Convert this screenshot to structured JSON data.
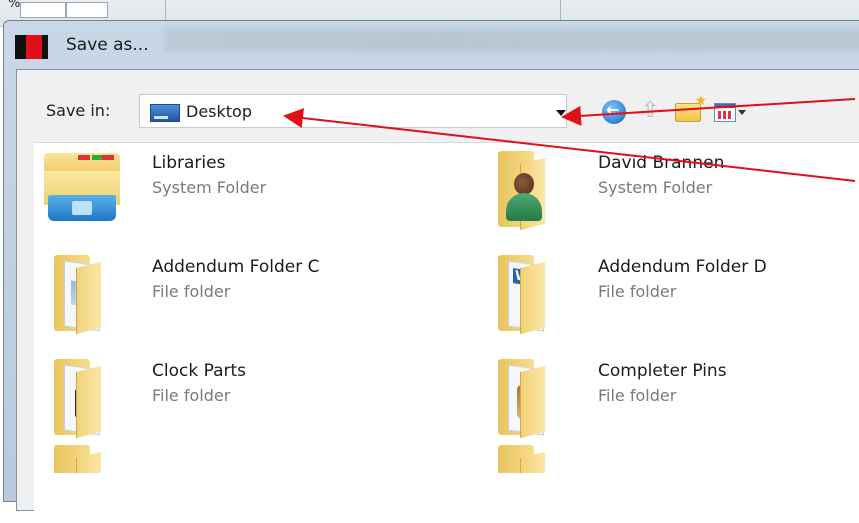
{
  "background": {
    "zoom_text": "%"
  },
  "dialog": {
    "title": "Save as..."
  },
  "save_in": {
    "label": "Save in:",
    "value": "Desktop"
  },
  "toolbar": {
    "icons": [
      "back-icon",
      "up-folder-icon",
      "new-folder-icon",
      "views-menu-icon"
    ]
  },
  "files": [
    {
      "name": "Libraries",
      "type": "System Folder",
      "icon": "libraries-icon"
    },
    {
      "name": "David Brannen",
      "type": "System Folder",
      "icon": "user-folder-icon"
    },
    {
      "name": "Addendum Folder C",
      "type": "File folder",
      "icon": "folder-icon"
    },
    {
      "name": "Addendum Folder D",
      "type": "File folder",
      "icon": "folder-icon"
    },
    {
      "name": "Clock Parts",
      "type": "File folder",
      "icon": "folder-icon"
    },
    {
      "name": "Completer Pins",
      "type": "File folder",
      "icon": "folder-icon"
    }
  ],
  "colors": {
    "annotation": "#e0101a",
    "title_bar": "#c9d7e6",
    "secondary_text": "#7a7a7a"
  }
}
